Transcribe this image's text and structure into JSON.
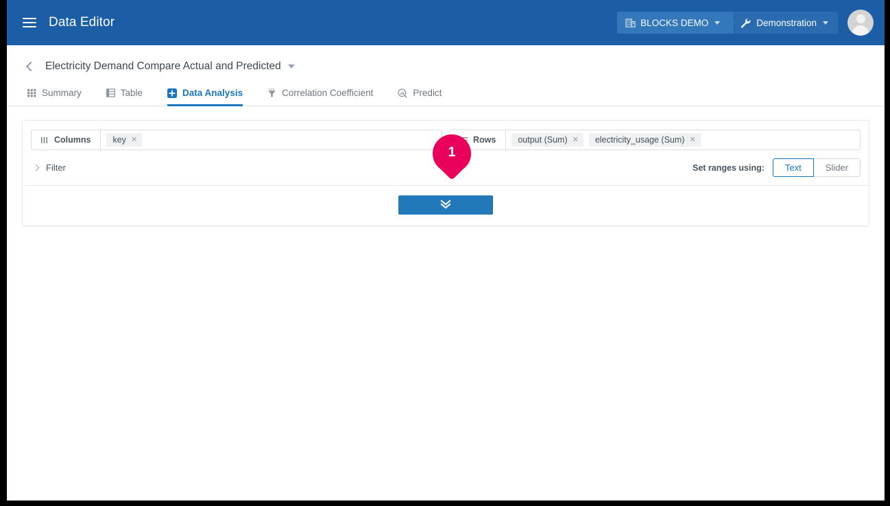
{
  "appbar": {
    "menu_icon": "hamburger-icon",
    "title": "Data Editor",
    "workspace": {
      "icon": "building-icon",
      "label": "BLOCKS DEMO"
    },
    "project": {
      "icon": "wrench-icon",
      "label": "Demonstration"
    },
    "avatar_icon": "user-avatar-icon"
  },
  "page": {
    "back_icon": "chevron-left-icon",
    "title": "Electricity Demand Compare Actual and Predicted",
    "title_caret_icon": "caret-down-icon"
  },
  "tabs": [
    {
      "label": "Summary",
      "icon": "grid-icon",
      "active": false
    },
    {
      "label": "Table",
      "icon": "table-icon",
      "active": false
    },
    {
      "label": "Data Analysis",
      "icon": "plus-square-icon",
      "active": true
    },
    {
      "label": "Correlation Coefficient",
      "icon": "funnel-icon",
      "active": false
    },
    {
      "label": "Predict",
      "icon": "magnifier-chart-icon",
      "active": false
    }
  ],
  "shelves": {
    "columns": {
      "icon": "columns-icon",
      "label": "Columns",
      "chips": [
        {
          "label": "key",
          "remove_icon": "close-icon"
        }
      ]
    },
    "rows": {
      "icon": "rows-icon",
      "label": "Rows",
      "chips": [
        {
          "label": "output (Sum)",
          "remove_icon": "close-icon"
        },
        {
          "label": "electricity_usage (Sum)",
          "remove_icon": "close-icon"
        }
      ]
    }
  },
  "filter": {
    "expand_icon": "chevron-right-icon",
    "label": "Filter"
  },
  "ranges": {
    "label": "Set ranges using:",
    "options": [
      {
        "label": "Text",
        "selected": true
      },
      {
        "label": "Slider",
        "selected": false
      }
    ]
  },
  "expand_button": {
    "icon": "double-chevron-down-icon",
    "label": ""
  },
  "annotation": {
    "step_number": "1",
    "color": "#e8005a"
  },
  "colors": {
    "appbar_bg": "#1b5ea6",
    "accent_blue": "#1a76bc",
    "button_blue": "#2279b9",
    "pin_pink": "#e8005a"
  }
}
